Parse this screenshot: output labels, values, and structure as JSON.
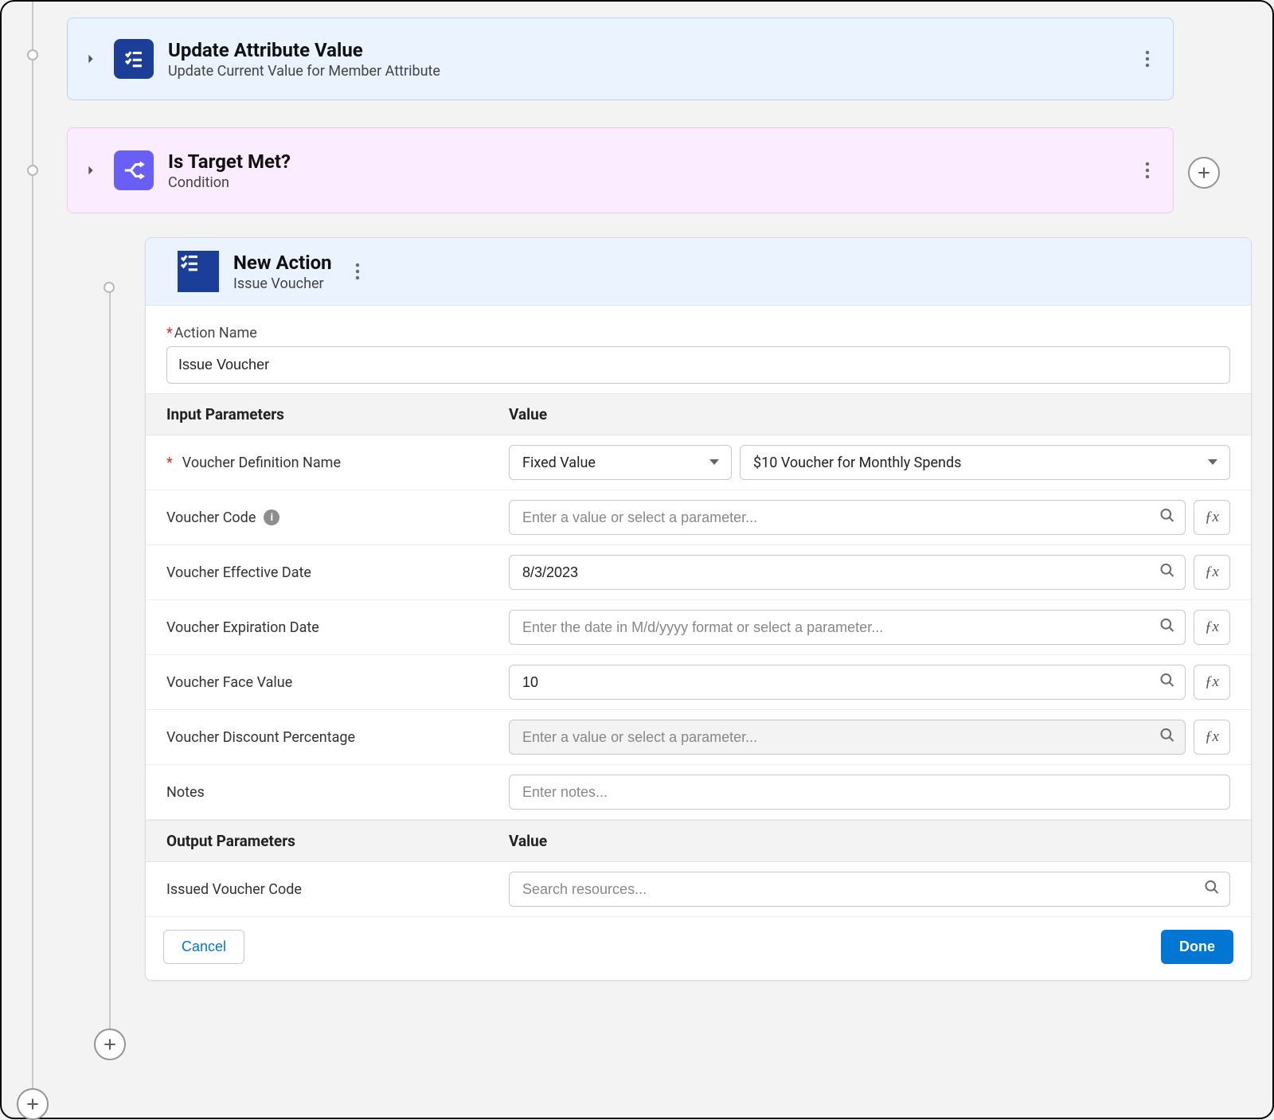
{
  "steps": {
    "update_attr": {
      "title": "Update Attribute Value",
      "subtitle": "Update Current Value for Member Attribute"
    },
    "target_met": {
      "title": "Is Target Met?",
      "subtitle": "Condition"
    },
    "new_action": {
      "title": "New Action",
      "subtitle": "Issue Voucher"
    }
  },
  "editor": {
    "action_name_label": "Action Name",
    "action_name_value": "Issue Voucher",
    "section_input": "Input Parameters",
    "section_value": "Value",
    "section_output": "Output Parameters",
    "params": {
      "voucher_definition": {
        "label": "Voucher Definition Name",
        "type_value": "Fixed Value",
        "lookup_value": "$10 Voucher for Monthly Spends"
      },
      "voucher_code": {
        "label": "Voucher Code",
        "placeholder": "Enter a value or select a parameter..."
      },
      "effective_date": {
        "label": "Voucher Effective Date",
        "value": "8/3/2023"
      },
      "expiration_date": {
        "label": "Voucher Expiration Date",
        "placeholder": "Enter the date in M/d/yyyy format or select a parameter..."
      },
      "face_value": {
        "label": "Voucher Face Value",
        "value": "10"
      },
      "discount_pct": {
        "label": "Voucher Discount Percentage",
        "placeholder": "Enter a value or select a parameter..."
      },
      "notes": {
        "label": "Notes",
        "placeholder": "Enter notes..."
      }
    },
    "output": {
      "issued_code": {
        "label": "Issued Voucher Code",
        "placeholder": "Search resources..."
      }
    },
    "buttons": {
      "cancel": "Cancel",
      "done": "Done"
    }
  },
  "glyphs": {
    "fx": "ƒx"
  }
}
